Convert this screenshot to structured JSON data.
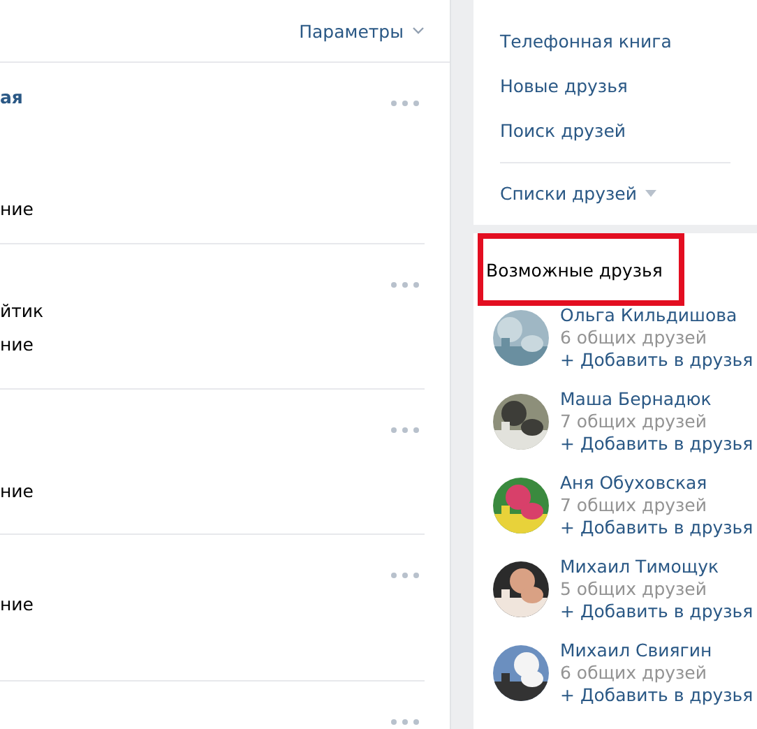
{
  "main": {
    "params_button": "Параметры",
    "rows": [
      {
        "lines": [
          {
            "kind": "bold",
            "text": "ая"
          },
          {
            "kind": "plain",
            "text": "ние"
          }
        ]
      },
      {
        "lines": [
          {
            "kind": "plain",
            "text": "йтик"
          },
          {
            "kind": "plain",
            "text": "ние"
          }
        ]
      },
      {
        "lines": [
          {
            "kind": "plain",
            "text": "ние"
          }
        ]
      },
      {
        "lines": [
          {
            "kind": "plain",
            "text": "ние"
          }
        ]
      },
      {
        "lines": []
      }
    ]
  },
  "sidebar": {
    "items": [
      "Телефонная книга",
      "Новые друзья",
      "Поиск друзей"
    ],
    "lists_menu": "Списки друзей"
  },
  "suggestions": {
    "title": "Возможные друзья",
    "highlighted": true,
    "people": [
      {
        "name": "Ольга Кильдишова",
        "mutual": "6 общих друзей",
        "add": "+ Добавить в друзья"
      },
      {
        "name": "Маша Бернадюк",
        "mutual": "7 общих друзей",
        "add": "+ Добавить в друзья"
      },
      {
        "name": "Аня Обуховская",
        "mutual": "7 общих друзей",
        "add": "+ Добавить в друзья"
      },
      {
        "name": "Михаил Тимощук",
        "mutual": "5 общих друзей",
        "add": "+ Добавить в друзья"
      },
      {
        "name": "Михаил Свиягин",
        "mutual": "6 общих друзей",
        "add": "+ Добавить в друзья"
      }
    ]
  }
}
